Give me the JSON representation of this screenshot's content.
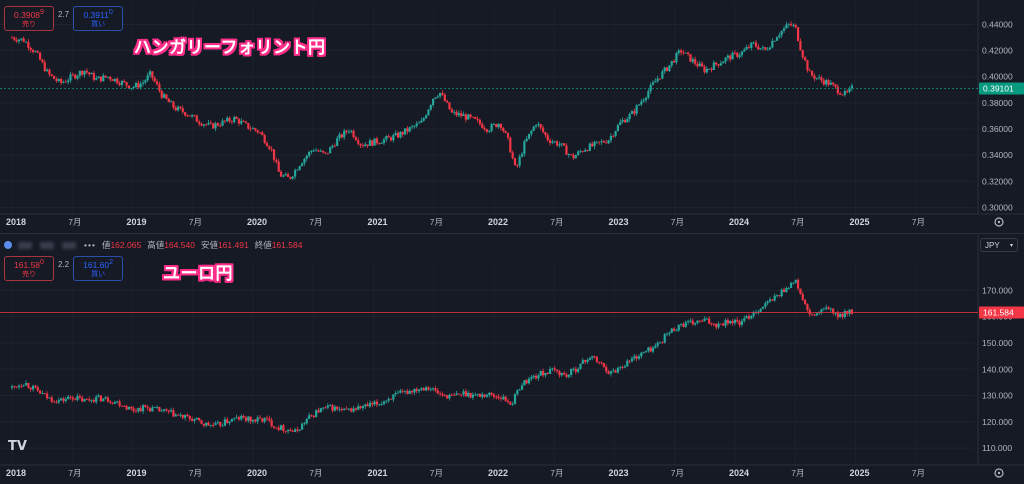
{
  "chart_data": [
    {
      "type": "candlestick",
      "title": "ハンガリーフォリント円",
      "x_ticks": [
        "2018",
        "7月",
        "2019",
        "7月",
        "2020",
        "7月",
        "2021",
        "7月",
        "2022",
        "7月",
        "2023",
        "7月",
        "2024",
        "7月",
        "2025",
        "7月"
      ],
      "y_ticks": [
        "0.44000",
        "0.42000",
        "0.40000",
        "0.38000",
        "0.36000",
        "0.34000",
        "0.32000",
        "0.30000"
      ],
      "ylim": [
        0.298,
        0.448
      ],
      "last_price": "0.39101",
      "last_value": 0.391,
      "sell": {
        "price": "0.3908",
        "sup": "9",
        "label": "売り"
      },
      "buy": {
        "price": "0.3911",
        "sup": "0",
        "label": "買い"
      },
      "spread": "2.7",
      "x_start": 2018.0,
      "x_end": 2024.97,
      "series": [
        [
          2018.0,
          0.43
        ],
        [
          2018.1,
          0.428
        ],
        [
          2018.2,
          0.418
        ],
        [
          2018.3,
          0.402
        ],
        [
          2018.4,
          0.395
        ],
        [
          2018.5,
          0.4
        ],
        [
          2018.6,
          0.405
        ],
        [
          2018.7,
          0.398
        ],
        [
          2018.8,
          0.4
        ],
        [
          2018.9,
          0.396
        ],
        [
          2019.0,
          0.392
        ],
        [
          2019.08,
          0.395
        ],
        [
          2019.15,
          0.402
        ],
        [
          2019.25,
          0.385
        ],
        [
          2019.35,
          0.376
        ],
        [
          2019.45,
          0.372
        ],
        [
          2019.55,
          0.366
        ],
        [
          2019.65,
          0.362
        ],
        [
          2019.75,
          0.365
        ],
        [
          2019.85,
          0.368
        ],
        [
          2019.95,
          0.362
        ],
        [
          2020.05,
          0.358
        ],
        [
          2020.15,
          0.345
        ],
        [
          2020.22,
          0.325
        ],
        [
          2020.3,
          0.322
        ],
        [
          2020.4,
          0.335
        ],
        [
          2020.5,
          0.345
        ],
        [
          2020.6,
          0.34
        ],
        [
          2020.7,
          0.352
        ],
        [
          2020.8,
          0.36
        ],
        [
          2020.9,
          0.348
        ],
        [
          2021.0,
          0.35
        ],
        [
          2021.1,
          0.352
        ],
        [
          2021.2,
          0.355
        ],
        [
          2021.3,
          0.36
        ],
        [
          2021.4,
          0.365
        ],
        [
          2021.5,
          0.385
        ],
        [
          2021.55,
          0.388
        ],
        [
          2021.65,
          0.372
        ],
        [
          2021.75,
          0.37
        ],
        [
          2021.85,
          0.366
        ],
        [
          2021.95,
          0.36
        ],
        [
          2022.05,
          0.365
        ],
        [
          2022.12,
          0.35
        ],
        [
          2022.18,
          0.328
        ],
        [
          2022.25,
          0.348
        ],
        [
          2022.35,
          0.365
        ],
        [
          2022.45,
          0.352
        ],
        [
          2022.55,
          0.348
        ],
        [
          2022.65,
          0.338
        ],
        [
          2022.75,
          0.345
        ],
        [
          2022.85,
          0.348
        ],
        [
          2022.95,
          0.352
        ],
        [
          2023.05,
          0.365
        ],
        [
          2023.15,
          0.372
        ],
        [
          2023.25,
          0.385
        ],
        [
          2023.35,
          0.398
        ],
        [
          2023.45,
          0.408
        ],
        [
          2023.55,
          0.42
        ],
        [
          2023.65,
          0.412
        ],
        [
          2023.75,
          0.405
        ],
        [
          2023.85,
          0.41
        ],
        [
          2023.95,
          0.415
        ],
        [
          2024.05,
          0.418
        ],
        [
          2024.15,
          0.425
        ],
        [
          2024.25,
          0.42
        ],
        [
          2024.35,
          0.432
        ],
        [
          2024.45,
          0.44
        ],
        [
          2024.5,
          0.438
        ],
        [
          2024.55,
          0.42
        ],
        [
          2024.62,
          0.402
        ],
        [
          2024.7,
          0.398
        ],
        [
          2024.78,
          0.395
        ],
        [
          2024.85,
          0.39
        ],
        [
          2024.92,
          0.386
        ],
        [
          2024.97,
          0.391
        ]
      ]
    },
    {
      "type": "candlestick",
      "title": "ユーロ円",
      "ohlc_labels": {
        "open_label": "値",
        "open": "162.065",
        "high_label": "高値",
        "high": "164.540",
        "low_label": "安値",
        "low": "161.491",
        "close_label": "終値",
        "close": "161.584"
      },
      "currency": "JPY",
      "x_ticks": [
        "2018",
        "7月",
        "2019",
        "7月",
        "2020",
        "7月",
        "2021",
        "7月",
        "2022",
        "7月",
        "2023",
        "7月",
        "2024",
        "7月",
        "2025",
        "7月"
      ],
      "y_ticks": [
        "170.000",
        "160.000",
        "150.000",
        "140.000",
        "130.000",
        "120.000",
        "110.000"
      ],
      "ylim": [
        107,
        177
      ],
      "last_price": "161.584",
      "last_value": 161.584,
      "sell": {
        "price": "161.58",
        "sup": "0",
        "label": "売り"
      },
      "buy": {
        "price": "161.60",
        "sup": "2",
        "label": "買い"
      },
      "spread": "2.2",
      "x_start": 2018.0,
      "x_end": 2024.97,
      "series": [
        [
          2018.0,
          133.0
        ],
        [
          2018.1,
          135.0
        ],
        [
          2018.2,
          132.0
        ],
        [
          2018.3,
          129.0
        ],
        [
          2018.4,
          128.0
        ],
        [
          2018.5,
          129.5
        ],
        [
          2018.6,
          128.0
        ],
        [
          2018.7,
          129.0
        ],
        [
          2018.8,
          128.5
        ],
        [
          2018.9,
          127.0
        ],
        [
          2019.0,
          124.5
        ],
        [
          2019.1,
          125.5
        ],
        [
          2019.2,
          124.5
        ],
        [
          2019.3,
          123.5
        ],
        [
          2019.4,
          122.0
        ],
        [
          2019.5,
          121.0
        ],
        [
          2019.6,
          119.0
        ],
        [
          2019.7,
          118.5
        ],
        [
          2019.8,
          120.5
        ],
        [
          2019.9,
          121.5
        ],
        [
          2020.0,
          120.5
        ],
        [
          2020.1,
          121.0
        ],
        [
          2020.2,
          118.0
        ],
        [
          2020.3,
          117.0
        ],
        [
          2020.35,
          116.0
        ],
        [
          2020.45,
          121.0
        ],
        [
          2020.55,
          124.5
        ],
        [
          2020.65,
          125.5
        ],
        [
          2020.75,
          124.0
        ],
        [
          2020.85,
          125.0
        ],
        [
          2020.95,
          126.0
        ],
        [
          2021.05,
          127.0
        ],
        [
          2021.15,
          129.5
        ],
        [
          2021.25,
          131.0
        ],
        [
          2021.35,
          132.5
        ],
        [
          2021.45,
          133.5
        ],
        [
          2021.55,
          130.5
        ],
        [
          2021.65,
          129.5
        ],
        [
          2021.75,
          131.0
        ],
        [
          2021.85,
          130.0
        ],
        [
          2021.95,
          130.5
        ],
        [
          2022.05,
          129.5
        ],
        [
          2022.15,
          127.0
        ],
        [
          2022.22,
          134.0
        ],
        [
          2022.3,
          136.5
        ],
        [
          2022.4,
          138.5
        ],
        [
          2022.5,
          139.5
        ],
        [
          2022.6,
          137.5
        ],
        [
          2022.7,
          141.0
        ],
        [
          2022.8,
          145.0
        ],
        [
          2022.9,
          141.5
        ],
        [
          2022.97,
          138.5
        ],
        [
          2023.05,
          141.0
        ],
        [
          2023.15,
          144.0
        ],
        [
          2023.25,
          146.5
        ],
        [
          2023.35,
          149.0
        ],
        [
          2023.45,
          154.0
        ],
        [
          2023.55,
          157.0
        ],
        [
          2023.65,
          157.5
        ],
        [
          2023.75,
          158.5
        ],
        [
          2023.85,
          157.0
        ],
        [
          2023.95,
          158.5
        ],
        [
          2024.05,
          157.5
        ],
        [
          2024.15,
          161.5
        ],
        [
          2024.25,
          164.5
        ],
        [
          2024.35,
          168.0
        ],
        [
          2024.45,
          172.0
        ],
        [
          2024.5,
          173.5
        ],
        [
          2024.55,
          168.0
        ],
        [
          2024.62,
          160.0
        ],
        [
          2024.7,
          161.5
        ],
        [
          2024.78,
          163.5
        ],
        [
          2024.85,
          159.5
        ],
        [
          2024.92,
          162.0
        ],
        [
          2024.97,
          161.584
        ]
      ]
    }
  ],
  "colors": {
    "up": "#26a69a",
    "down": "#f23645",
    "axis_text": "#b2b5be",
    "last_top": "#089981",
    "last_bottom": "#f23645"
  },
  "logo": "TV"
}
